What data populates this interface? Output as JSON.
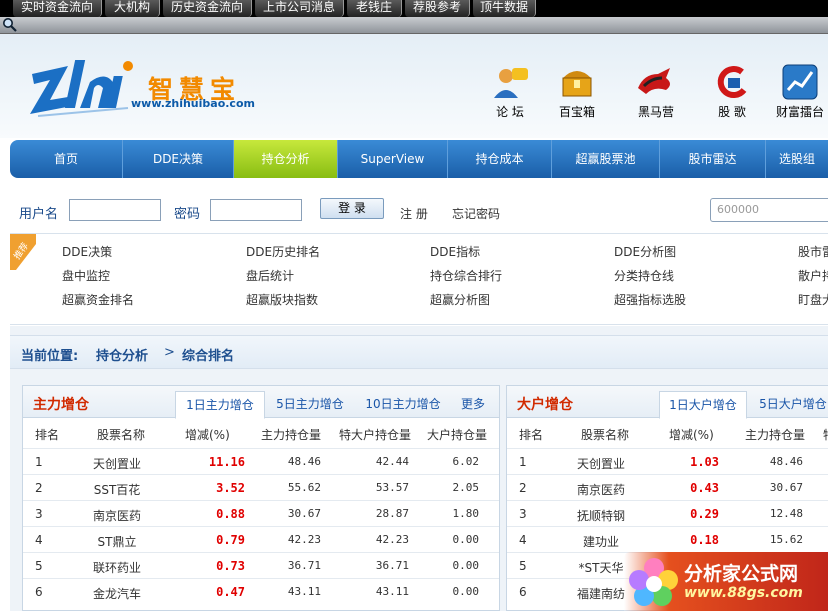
{
  "top_tabs": [
    "实时资金流向",
    "大机构",
    "历史资金流向",
    "上市公司消息",
    "老钱庄",
    "荐股参考",
    "顶牛数据"
  ],
  "brand": {
    "name": "智慧宝",
    "url": "www.zhihuibao.com"
  },
  "header_icons": [
    {
      "icon": "forum-icon",
      "label": "论 坛"
    },
    {
      "icon": "treasure-chest-icon",
      "label": "百宝箱"
    },
    {
      "icon": "dark-horse-icon",
      "label": "黑马营"
    },
    {
      "icon": "stock-song-icon",
      "label": "股 歌"
    },
    {
      "icon": "wealth-stage-icon",
      "label": "财富擂台"
    }
  ],
  "nav": [
    "首页",
    "DDE决策",
    "持仓分析",
    "SuperView",
    "持仓成本",
    "超赢股票池",
    "股市雷达",
    "选股组"
  ],
  "nav_active_index": 2,
  "login": {
    "user_label": "用户名",
    "password_label": "密码",
    "login_button": "登 录",
    "register": "注 册",
    "forgot": "忘记密码",
    "stock_placeholder": "600000"
  },
  "recommend": {
    "tag": "推荐",
    "links": [
      [
        "DDE决策",
        "DDE历史排名",
        "DDE指标",
        "DDE分析图",
        "股市雷"
      ],
      [
        "盘中监控",
        "盘后统计",
        "持仓综合排行",
        "分类持仓线",
        "散户持"
      ],
      [
        "超赢资金排名",
        "超赢版块指数",
        "超赢分析图",
        "超强指标选股",
        "盯盘大"
      ]
    ]
  },
  "breadcrumb": {
    "label": "当前位置:",
    "section": "持仓分析",
    "sep": ">",
    "page": "综合排名"
  },
  "panel_main": {
    "title": "主力增仓",
    "tabs": [
      "1日主力增仓",
      "5日主力增仓",
      "10日主力增仓",
      "更多"
    ],
    "columns": [
      "排名",
      "股票名称",
      "增减(%)",
      "主力持仓量",
      "特大户持仓量",
      "大户持仓量"
    ],
    "rows": [
      [
        "1",
        "天创置业",
        "11.16",
        "48.46",
        "42.44",
        "6.02"
      ],
      [
        "2",
        "SST百花",
        "3.52",
        "55.62",
        "53.57",
        "2.05"
      ],
      [
        "3",
        "南京医药",
        "0.88",
        "30.67",
        "28.87",
        "1.80"
      ],
      [
        "4",
        "ST鼎立",
        "0.79",
        "42.23",
        "42.23",
        "0.00"
      ],
      [
        "5",
        "联环药业",
        "0.73",
        "36.71",
        "36.71",
        "0.00"
      ],
      [
        "6",
        "金龙汽车",
        "0.47",
        "43.11",
        "43.11",
        "0.00"
      ]
    ]
  },
  "panel_big": {
    "title": "大户增仓",
    "tabs": [
      "1日大户增仓",
      "5日大户增仓"
    ],
    "columns": [
      "排名",
      "股票名称",
      "增减(%)",
      "主力持仓量",
      "特"
    ],
    "rows": [
      [
        "1",
        "天创置业",
        "1.03",
        "48.46"
      ],
      [
        "2",
        "南京医药",
        "0.43",
        "30.67"
      ],
      [
        "3",
        "抚顺特钢",
        "0.29",
        "12.48"
      ],
      [
        "4",
        "建功业",
        "0.18",
        "15.62"
      ],
      [
        "5",
        "*ST天华",
        "",
        ""
      ],
      [
        "6",
        "福建南纺",
        "",
        ""
      ]
    ]
  },
  "watermark": {
    "title": "分析家公式网",
    "url": "www.88gs.com"
  }
}
